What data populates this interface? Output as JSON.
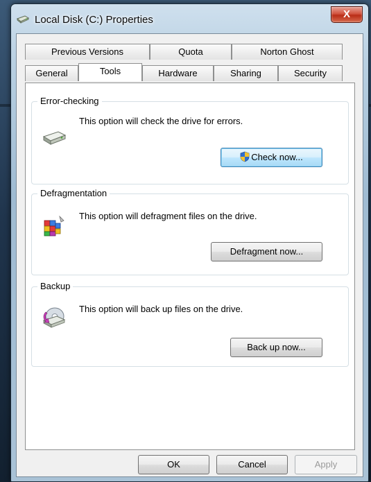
{
  "window": {
    "title": "Local Disk (C:) Properties",
    "close_glyph": "X"
  },
  "tabs": {
    "row1": [
      {
        "label": "Previous Versions"
      },
      {
        "label": "Quota"
      },
      {
        "label": "Norton Ghost"
      }
    ],
    "row2": [
      {
        "label": "General"
      },
      {
        "label": "Tools",
        "active": true
      },
      {
        "label": "Hardware"
      },
      {
        "label": "Sharing"
      },
      {
        "label": "Security"
      }
    ]
  },
  "groups": {
    "error_checking": {
      "label": "Error-checking",
      "desc": "This option will check the drive for errors.",
      "button": "Check now...",
      "icon": "drive-icon"
    },
    "defrag": {
      "label": "Defragmentation",
      "desc": "This option will defragment files on the drive.",
      "button": "Defragment now...",
      "icon": "defragment-icon"
    },
    "backup": {
      "label": "Backup",
      "desc": "This option will back up files on the drive.",
      "button": "Back up now...",
      "icon": "backup-icon"
    }
  },
  "footer": {
    "ok": "OK",
    "cancel": "Cancel",
    "apply": "Apply"
  },
  "colors": {
    "accent": "#3c7fb1",
    "close": "#c6422c"
  }
}
